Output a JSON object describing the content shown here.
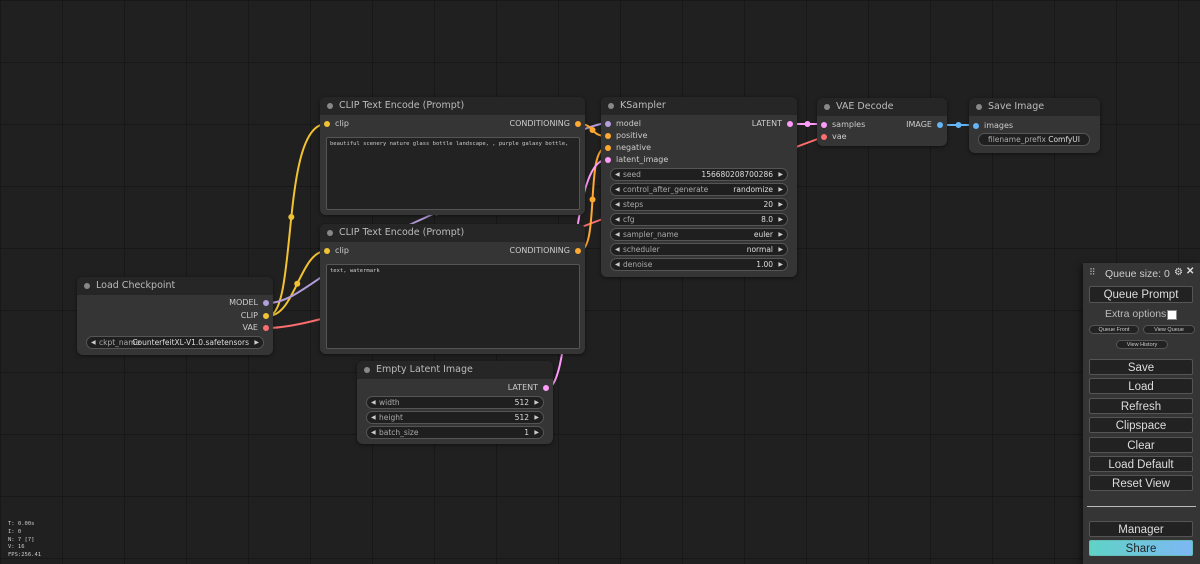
{
  "colors": {
    "model": "#b39ddb",
    "clip": "#f1c232",
    "vae": "#ff6e6e",
    "conditioning": "#ffa931",
    "latent": "#ff9cf9",
    "image": "#64b5f6",
    "share_button": "#7ec8f0"
  },
  "nodes": {
    "clip_pos": {
      "title": "CLIP Text Encode (Prompt)",
      "in_clip": "clip",
      "out_conditioning": "CONDITIONING",
      "text": "beautiful scenery nature glass bottle landscape, , purple galaxy bottle,"
    },
    "clip_neg": {
      "title": "CLIP Text Encode (Prompt)",
      "in_clip": "clip",
      "out_conditioning": "CONDITIONING",
      "text": "text, watermark"
    },
    "checkpoint": {
      "title": "Load Checkpoint",
      "out_model": "MODEL",
      "out_clip": "CLIP",
      "out_vae": "VAE",
      "ckpt_label": "ckpt_name",
      "ckpt_value": "CounterfeitXL-V1.0.safetensors"
    },
    "latent": {
      "title": "Empty Latent Image",
      "out_latent": "LATENT",
      "widgets": [
        {
          "label": "width",
          "value": "512"
        },
        {
          "label": "height",
          "value": "512"
        },
        {
          "label": "batch_size",
          "value": "1"
        }
      ]
    },
    "ksampler": {
      "title": "KSampler",
      "in_model": "model",
      "in_positive": "positive",
      "in_negative": "negative",
      "in_latent": "latent_image",
      "out_latent": "LATENT",
      "widgets": [
        {
          "label": "seed",
          "value": "156680208700286"
        },
        {
          "label": "control_after_generate",
          "value": "randomize"
        },
        {
          "label": "steps",
          "value": "20"
        },
        {
          "label": "cfg",
          "value": "8.0"
        },
        {
          "label": "sampler_name",
          "value": "euler"
        },
        {
          "label": "scheduler",
          "value": "normal"
        },
        {
          "label": "denoise",
          "value": "1.00"
        }
      ]
    },
    "vae_decode": {
      "title": "VAE Decode",
      "in_samples": "samples",
      "in_vae": "vae",
      "out_image": "IMAGE"
    },
    "save_image": {
      "title": "Save Image",
      "in_images": "images",
      "prefix_label": "filename_prefix",
      "prefix_value": "ComfyUI"
    }
  },
  "status": {
    "t": "T: 0.00s",
    "i": "I: 0",
    "n": "N: 7 [7]",
    "v": "V: 16",
    "fps": "FPS:256.41"
  },
  "menu": {
    "queue_size": "Queue size: 0",
    "queue_prompt": "Queue Prompt",
    "extra_options": "Extra options",
    "queue_front": "Queue Front",
    "view_queue": "View Queue",
    "view_history": "View History",
    "save": "Save",
    "load": "Load",
    "refresh": "Refresh",
    "clipspace": "Clipspace",
    "clear": "Clear",
    "load_default": "Load Default",
    "reset_view": "Reset View",
    "manager": "Manager",
    "share": "Share"
  }
}
